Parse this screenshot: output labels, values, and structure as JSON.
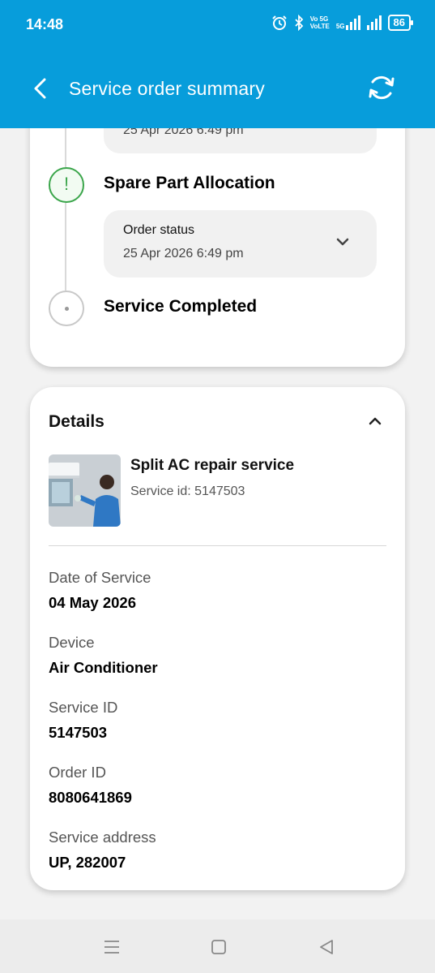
{
  "status_bar": {
    "time": "14:48",
    "network_small": "Vo 5G\nVoLTE",
    "network_5g": "5G",
    "battery": "86"
  },
  "app_bar": {
    "title": "Service order summary",
    "back_icon": "back-arrow-icon",
    "refresh_icon": "refresh-icon",
    "color": "#079ddb"
  },
  "timeline": {
    "top_partial_date": "25 Apr 2026 6:49 pm",
    "steps": [
      {
        "title": "Spare Part Allocation",
        "state": "active",
        "status_label": "Order status",
        "status_date": "25 Apr 2026 6:49 pm"
      },
      {
        "title": "Service Completed",
        "state": "pending"
      }
    ]
  },
  "details": {
    "title": "Details",
    "service_name": "Split AC repair service",
    "service_id_line": "Service id: 5147503",
    "fields": [
      {
        "label": "Date of Service",
        "value": "04 May 2026"
      },
      {
        "label": "Device",
        "value": "Air Conditioner"
      },
      {
        "label": "Service ID",
        "value": "5147503"
      },
      {
        "label": "Order ID",
        "value": "8080641869"
      },
      {
        "label": "Service address",
        "value": "UP, 282007"
      }
    ]
  },
  "nav_bar": {
    "menu_icon": "menu-icon",
    "home_icon": "home-icon",
    "back_icon": "back-triangle-icon"
  }
}
